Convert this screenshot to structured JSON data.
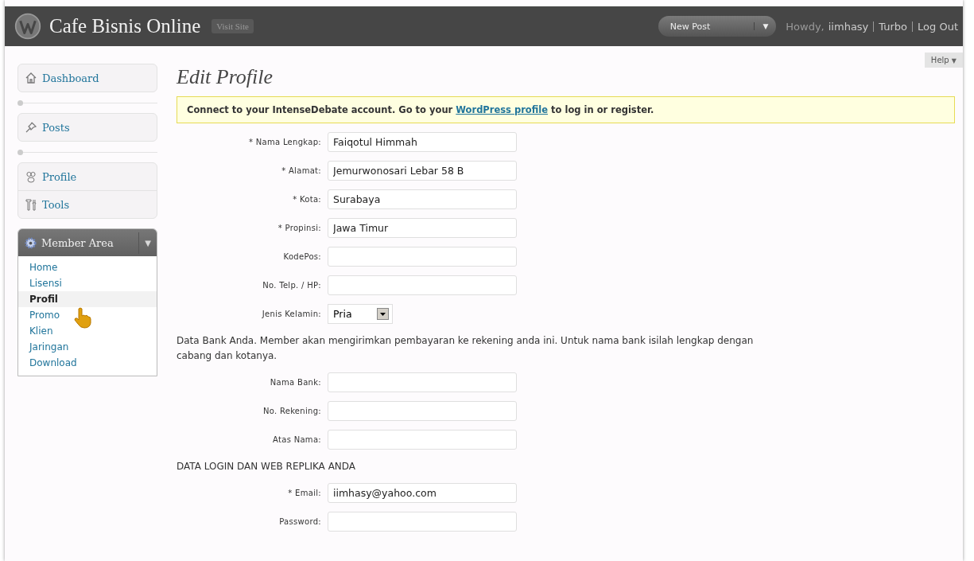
{
  "header": {
    "site_title": "Cafe Bisnis Online",
    "visit_site": "Visit Site",
    "new_post": "New Post",
    "new_post_caret": "▼",
    "howdy": "Howdy,",
    "user": "iimhasy",
    "links": [
      "Turbo",
      "Log Out"
    ]
  },
  "help": {
    "label": "Help",
    "caret": "▼"
  },
  "sidebar": {
    "groups": [
      {
        "items": [
          {
            "label": "Dashboard"
          }
        ]
      },
      {
        "items": [
          {
            "label": "Posts"
          }
        ]
      },
      {
        "items": [
          {
            "label": "Profile"
          },
          {
            "label": "Tools"
          }
        ]
      }
    ],
    "member_area": {
      "title": "Member Area",
      "caret": "▼",
      "items": [
        {
          "label": "Home",
          "selected": false
        },
        {
          "label": "Lisensi",
          "selected": false
        },
        {
          "label": "Profil",
          "selected": true
        },
        {
          "label": "Promo",
          "selected": false
        },
        {
          "label": "Klien",
          "selected": false
        },
        {
          "label": "Jaringan",
          "selected": false
        },
        {
          "label": "Download",
          "selected": false
        }
      ]
    }
  },
  "page_title": "Edit Profile",
  "notice": {
    "before": "Connect to your IntenseDebate account. Go to your ",
    "link": "WordPress profile",
    "after": " to log in or register."
  },
  "sections": [
    {
      "fields": [
        {
          "label": "* Nama Lengkap:",
          "value": "Faiqotul Himmah",
          "kind": "text"
        },
        {
          "label": "* Alamat:",
          "value": "Jemurwonosari Lebar 58 B",
          "kind": "text"
        },
        {
          "label": "* Kota:",
          "value": "Surabaya",
          "kind": "text"
        },
        {
          "label": "* Propinsi:",
          "value": "Jawa Timur",
          "kind": "text"
        },
        {
          "label": "KodePos:",
          "kind": "text"
        },
        {
          "label": "No. Telp. / HP:",
          "kind": "text"
        },
        {
          "label": "Jenis Kelamin:",
          "value": "Pria",
          "kind": "select"
        }
      ]
    },
    {
      "intro": "Data Bank Anda. Member akan mengirimkan pembayaran ke rekening anda ini. Untuk nama bank isilah lengkap dengan cabang dan kotanya.",
      "fields": [
        {
          "label": "Nama Bank:",
          "kind": "text"
        },
        {
          "label": "No. Rekening:",
          "kind": "text"
        },
        {
          "label": "Atas Nama:",
          "kind": "text"
        }
      ]
    },
    {
      "intro": "DATA LOGIN DAN WEB REPLIKA ANDA",
      "fields": [
        {
          "label": "* Email:",
          "value": "iimhasy@yahoo.com",
          "kind": "text"
        },
        {
          "label": "Password:",
          "kind": "text"
        }
      ]
    }
  ]
}
